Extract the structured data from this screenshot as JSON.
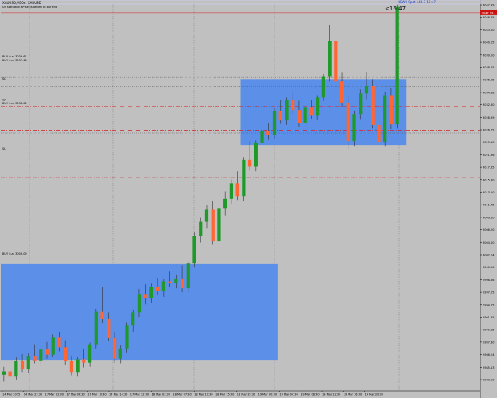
{
  "window": {
    "symbol_line": "XAUUSD,M30e: XAUUSD",
    "subtitle_line": "US standard: 6* sec/side left to bar end"
  },
  "header": {
    "server_time": "NEW0 Spot 143.7 16:47",
    "countdown": "<16:47"
  },
  "annotations": {
    "label_a": "BUY 0.at 3039.61",
    "label_b": "BUY 0.at 3037.46",
    "label_c": "SL",
    "label_d": "TP",
    "label_e": "BUY 0.at 3034.04",
    "label_f": "SL",
    "label_g": "BUY 0.at 3003.09"
  },
  "colors": {
    "background": "#c0c0c0",
    "bull": "#1f9a2a",
    "bear": "#ff6633",
    "zone": "#5b8fe8",
    "level_line": "#d42020",
    "current_price_tag": "#cc1111",
    "grid": "#8a8a8a"
  },
  "chart_data": {
    "type": "candlestick",
    "price_axis_ticks": [
      "3047.99",
      "3046.35",
      "3043.00",
      "3040.25",
      "3039.20",
      "3038.45",
      "3036.55",
      "3034.88",
      "3032.60",
      "3028.99",
      "3026.05",
      "3025.10",
      "3021.36",
      "3017.65",
      "3015.30",
      "3013.20",
      "3011.75",
      "3009.10",
      "3006.20",
      "3004.00",
      "3002.24",
      "3000.50",
      "2998.66",
      "2997.25",
      "2994.15",
      "2991.35",
      "2990.15",
      "2987.80",
      "2986.24",
      "2985.13",
      "2983.20"
    ],
    "current_price": "3047.99",
    "time_axis_ticks": [
      "14 Mar 2025",
      "14 Mar 23:30",
      "17 Mar 02:30",
      "17 Mar 06:30",
      "17 Mar 10:30",
      "17 Mar 14:30",
      "17 Mar 22:30",
      "18 Mar 03:30",
      "18 Mar 07:30",
      "18 Mar 11:30",
      "18 Mar 15:30",
      "18 Mar 19:30",
      "19 Mar 00:30",
      "19 Mar 04:30",
      "19 Mar 08:30",
      "19 Mar 12:30",
      "19 Mar 16:30",
      "19 Mar 20:30"
    ],
    "y_range": [
      2982.0,
      3049.5
    ],
    "zones": [
      {
        "x_start": 0,
        "x_end": 44,
        "y_low": 2987.4,
        "y_high": 3004.1
      },
      {
        "x_start": 39,
        "x_end": 65,
        "y_low": 3024.9,
        "y_high": 3036.4
      }
    ],
    "levels": [
      {
        "label": "SL",
        "y": 3031.6,
        "style": "dash"
      },
      {
        "label": "TP",
        "y": 3027.5,
        "style": "dash"
      },
      {
        "label": "SL",
        "y": 3019.2,
        "style": "dash"
      }
    ],
    "dotted_levels": [
      3036.7,
      3035.1,
      3027.0
    ],
    "candles": [
      [
        2984.8,
        2986.2,
        2983.6,
        2985.4
      ],
      [
        2985.4,
        2986.8,
        2984.2,
        2984.6
      ],
      [
        2984.6,
        2987.8,
        2983.9,
        2987.2
      ],
      [
        2987.2,
        2988.4,
        2985.3,
        2985.8
      ],
      [
        2985.8,
        2988.6,
        2985.1,
        2988.1
      ],
      [
        2988.1,
        2990.1,
        2986.8,
        2987.3
      ],
      [
        2987.3,
        2989.6,
        2986.5,
        2989.2
      ],
      [
        2989.2,
        2990.5,
        2987.6,
        2988.3
      ],
      [
        2988.3,
        2991.8,
        2987.9,
        2991.4
      ],
      [
        2991.4,
        2992.3,
        2988.9,
        2989.6
      ],
      [
        2989.6,
        2990.8,
        2986.6,
        2987.2
      ],
      [
        2987.2,
        2988.1,
        2984.7,
        2985.3
      ],
      [
        2985.3,
        2987.9,
        2984.6,
        2987.5
      ],
      [
        2987.5,
        2989.3,
        2986.1,
        2986.9
      ],
      [
        2986.9,
        2990.4,
        2986.2,
        2990.1
      ],
      [
        2990.1,
        2996.3,
        2989.4,
        2995.8
      ],
      [
        2995.8,
        3000.2,
        2993.8,
        2994.5
      ],
      [
        2994.5,
        2995.7,
        2990.6,
        2991.2
      ],
      [
        2991.2,
        2992.3,
        2986.9,
        2987.6
      ],
      [
        2987.6,
        2989.9,
        2986.8,
        2989.4
      ],
      [
        2989.4,
        2993.9,
        2988.7,
        2993.5
      ],
      [
        2993.5,
        2996.2,
        2992.3,
        2995.7
      ],
      [
        2995.7,
        2999.8,
        2994.9,
        2998.9
      ],
      [
        2998.9,
        3000.6,
        2997.1,
        2998.1
      ],
      [
        2998.1,
        3000.7,
        2997.3,
        3000.2
      ],
      [
        3000.2,
        3001.7,
        2998.8,
        2999.4
      ],
      [
        2999.4,
        3001.6,
        2998.4,
        3001.1
      ],
      [
        3001.1,
        3002.8,
        3000.1,
        3000.8
      ],
      [
        3000.8,
        3002.3,
        2999.9,
        3001.6
      ],
      [
        3001.6,
        3003.9,
        2999.2,
        2999.9
      ],
      [
        2999.9,
        3004.6,
        2999.1,
        3004.2
      ],
      [
        3004.2,
        3009.6,
        3003.5,
        3009.0
      ],
      [
        3009.0,
        3012.2,
        3007.9,
        3011.5
      ],
      [
        3011.5,
        3014.4,
        3010.3,
        3013.6
      ],
      [
        3013.6,
        3015.2,
        3007.5,
        3008.1
      ],
      [
        3008.1,
        3014.3,
        3007.2,
        3013.9
      ],
      [
        3013.9,
        3016.8,
        3012.6,
        3015.5
      ],
      [
        3015.5,
        3018.9,
        3014.6,
        3018.2
      ],
      [
        3018.2,
        3020.3,
        3015.3,
        3016.0
      ],
      [
        3016.0,
        3022.8,
        3015.2,
        3022.3
      ],
      [
        3022.3,
        3025.6,
        3020.4,
        3021.1
      ],
      [
        3021.1,
        3025.7,
        3020.3,
        3025.2
      ],
      [
        3025.2,
        3027.9,
        3023.8,
        3027.4
      ],
      [
        3027.4,
        3028.7,
        3025.8,
        3026.6
      ],
      [
        3026.6,
        3031.3,
        3025.9,
        3030.8
      ],
      [
        3030.8,
        3032.8,
        3028.6,
        3029.2
      ],
      [
        3029.2,
        3033.2,
        3028.4,
        3032.7
      ],
      [
        3032.7,
        3034.3,
        3030.3,
        3031.0
      ],
      [
        3031.0,
        3032.6,
        3028.1,
        3028.8
      ],
      [
        3028.8,
        3031.8,
        3028.0,
        3031.4
      ],
      [
        3031.4,
        3032.7,
        3029.4,
        3030.0
      ],
      [
        3030.0,
        3033.6,
        3029.2,
        3033.2
      ],
      [
        3033.2,
        3037.3,
        3032.6,
        3036.8
      ],
      [
        3036.8,
        3045.8,
        3036.0,
        3043.1
      ],
      [
        3043.1,
        3044.4,
        3035.5,
        3036.0
      ],
      [
        3036.0,
        3037.5,
        3031.6,
        3032.3
      ],
      [
        3032.3,
        3033.6,
        3024.2,
        3025.6
      ],
      [
        3025.6,
        3030.9,
        3024.6,
        3030.3
      ],
      [
        3030.3,
        3034.6,
        3029.3,
        3033.9
      ],
      [
        3033.9,
        3037.6,
        3032.9,
        3035.2
      ],
      [
        3035.2,
        3036.4,
        3027.8,
        3028.4
      ],
      [
        3028.4,
        3033.3,
        3024.8,
        3025.4
      ],
      [
        3025.4,
        3034.2,
        3024.6,
        3033.6
      ],
      [
        3033.6,
        3034.8,
        3027.7,
        3028.5
      ],
      [
        3028.5,
        3049.4,
        3027.8,
        3049.0
      ]
    ]
  }
}
